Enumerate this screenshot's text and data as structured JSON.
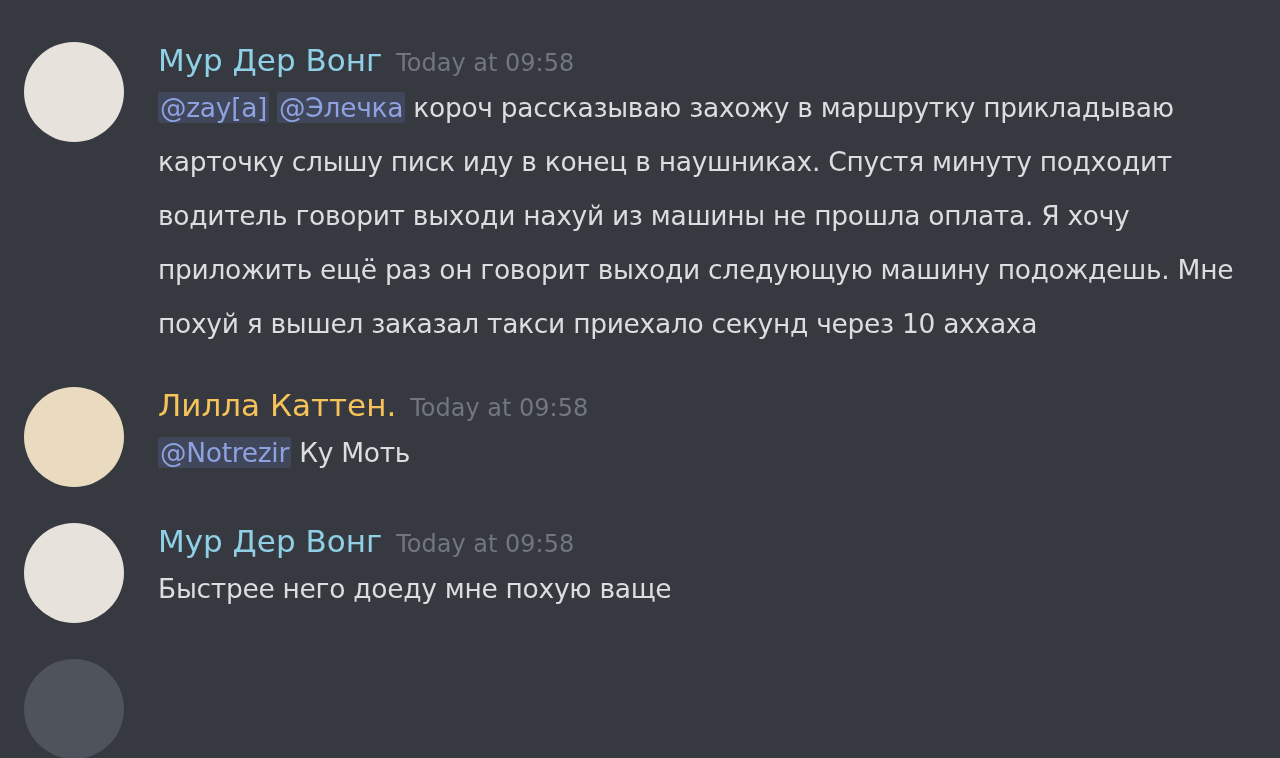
{
  "messages": [
    {
      "author": "Мур Дер Вонг",
      "color": "#8fd0e6",
      "time": "Today at 09:58",
      "segments": [
        {
          "kind": "mention",
          "text": "@zay[a]"
        },
        {
          "kind": "mention",
          "text": "@Элечка"
        },
        {
          "kind": "text",
          "text": " короч рассказываю захожу в маршрутку прикладываю карточку слышу писк иду в конец в наушниках. Спустя минуту подходит водитель говорит выходи нахуй из машины не прошла оплата. Я хочу приложить ещё раз он говорит выходи следующую машину подождешь. Мне похуй я вышел заказал такси приехало секунд через 10 аххаха"
        }
      ]
    },
    {
      "author": "Лилла Каттен.",
      "color": "#f6c35a",
      "time": "Today at 09:58",
      "segments": [
        {
          "kind": "mention",
          "text": "@Notrezir"
        },
        {
          "kind": "text",
          "text": " Ку Моть"
        }
      ]
    },
    {
      "author": "Мур Дер Вонг",
      "color": "#8fd0e6",
      "time": "Today at 09:58",
      "segments": [
        {
          "kind": "text",
          "text": "Быстрее него доеду мне похую ваще"
        }
      ]
    }
  ]
}
